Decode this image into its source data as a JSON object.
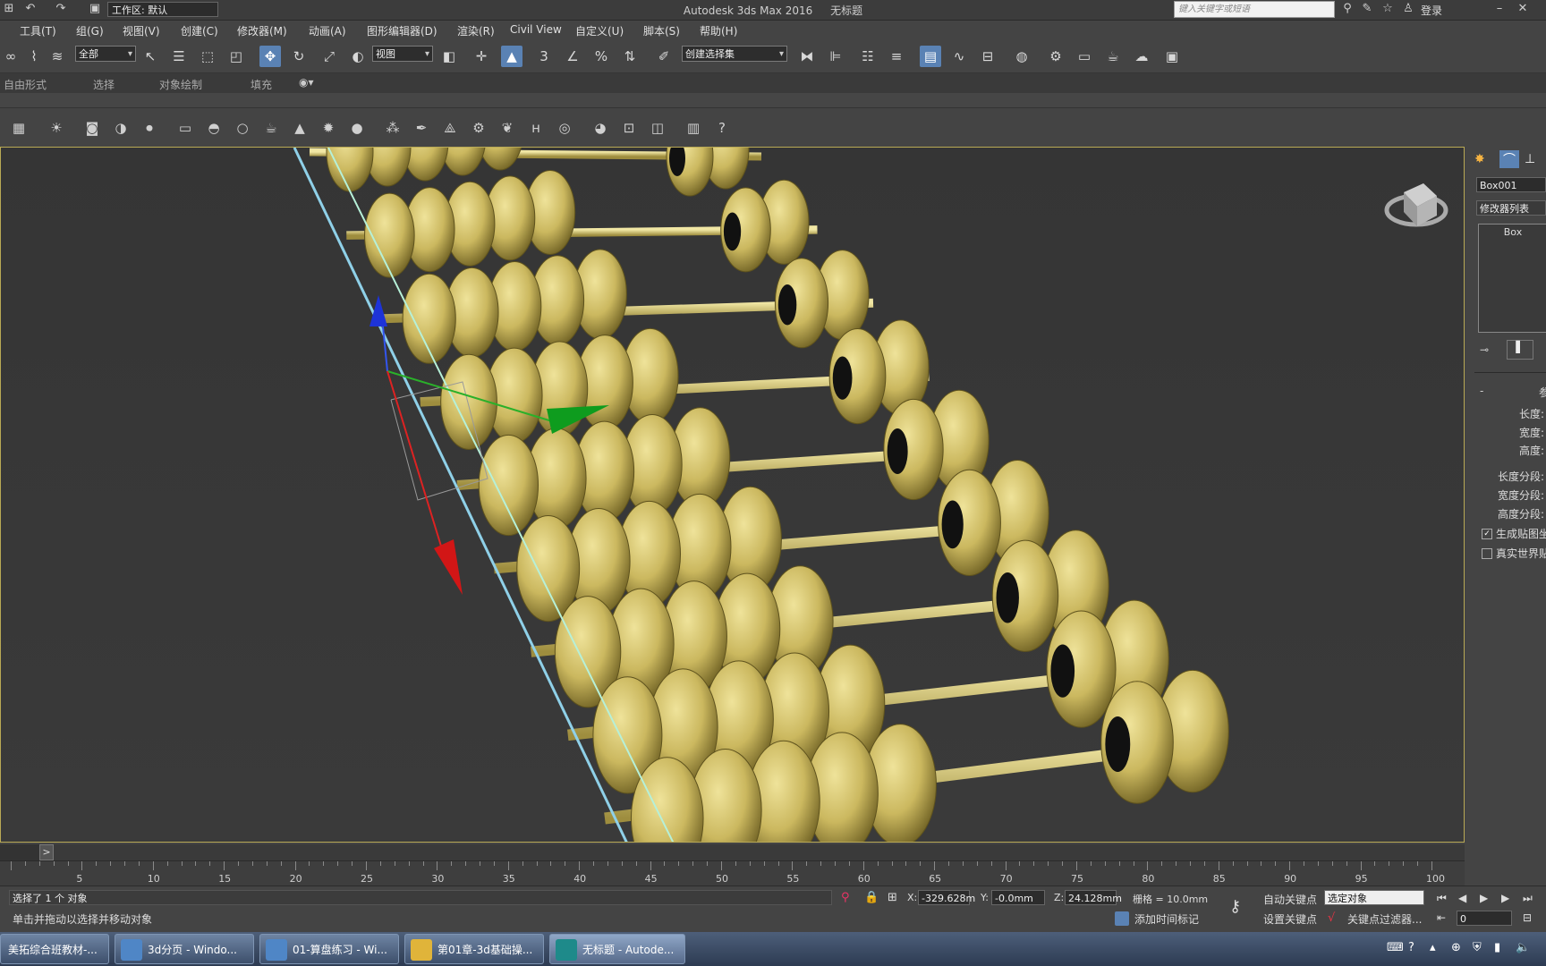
{
  "titlebar": {
    "app_title": "Autodesk 3ds Max 2016",
    "doc_title": "无标题",
    "workspace": "工作区: 默认",
    "search_placeholder": "键入关键字或短语",
    "login": "登录"
  },
  "menu": [
    "工具(T)",
    "组(G)",
    "视图(V)",
    "创建(C)",
    "修改器(M)",
    "动画(A)",
    "图形编辑器(D)",
    "渲染(R)",
    "Civil View",
    "自定义(U)",
    "脚本(S)",
    "帮助(H)"
  ],
  "toolbar": {
    "selection_filter": "全部",
    "reference_coord": "视图",
    "snap_3": "3",
    "named_selection": "创建选择集"
  },
  "ribbon_tabs": [
    "自由形式",
    "选择",
    "对象绘制",
    "填充"
  ],
  "command_panel": {
    "object_name": "Box001",
    "modifier_list": "修改器列表",
    "stack_item": "Box",
    "rollout_title": "参",
    "params": [
      "长度:",
      "宽度:",
      "高度:",
      "长度分段:",
      "宽度分段:",
      "高度分段:"
    ],
    "checkboxes": [
      {
        "label": "生成贴图坐",
        "checked": true
      },
      {
        "label": "真实世界贴",
        "checked": false
      }
    ]
  },
  "timeline": {
    "toggle": ">",
    "ticks": [
      "5",
      "10",
      "15",
      "20",
      "25",
      "30",
      "35",
      "40",
      "45",
      "50",
      "55",
      "60",
      "65",
      "70",
      "75",
      "80",
      "85",
      "90",
      "95",
      "100"
    ]
  },
  "status": {
    "selection_text": "选择了 1 个 对象",
    "prompt_text": "单击并拖动以选择并移动对象",
    "x_label": "X:",
    "x_value": "-329.628m",
    "y_label": "Y:",
    "y_value": "-0.0mm",
    "z_label": "Z:",
    "z_value": "24.128mm",
    "grid": "栅格 = 10.0mm",
    "auto_key": "自动关键点",
    "set_key": "设置关键点",
    "key_mode": "选定对象",
    "key_filters": "关键点过滤器...",
    "add_time_tag": "添加时间标记",
    "frame": "0"
  },
  "taskbar": [
    {
      "label": "美拓综合班教材-...",
      "color": "#3a6ea5"
    },
    {
      "label": "3d分页 - Windo...",
      "color": "#4f86c6"
    },
    {
      "label": "01-算盘练习 - Wi...",
      "color": "#4f86c6"
    },
    {
      "label": "第01章-3d基础操...",
      "color": "#e0b43a"
    },
    {
      "label": "无标题 - Autode...",
      "color": "#1e8a8a"
    }
  ],
  "colors": {
    "accent_active": "#5a82b4",
    "bead": "#cbb85f",
    "viewport_border": "#b9a955"
  }
}
